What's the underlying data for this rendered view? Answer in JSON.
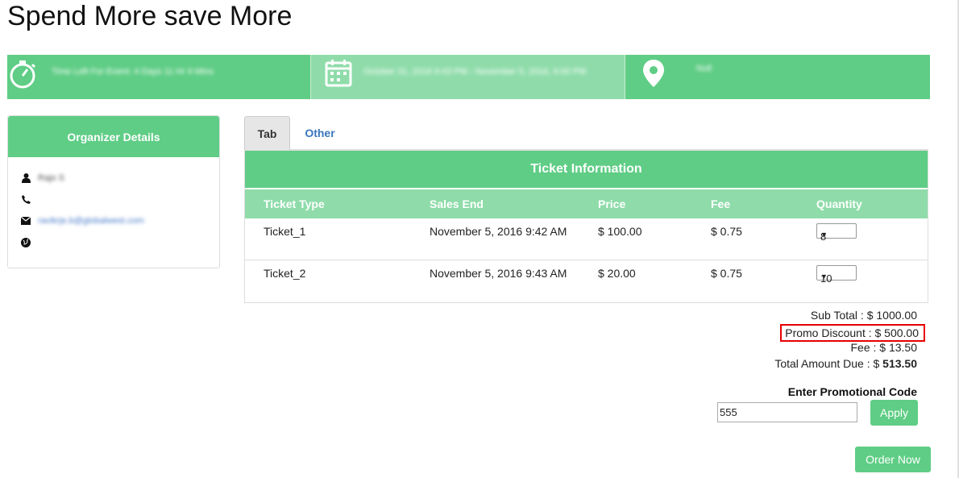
{
  "page": {
    "title": "Spend More save More"
  },
  "info_bar": {
    "time_left": "Time Left For Event: 4 Days 11 Hr 9 Mins",
    "date_range": "October 31, 2016 9:43 PM - November 5, 2016, 9:00 PM",
    "location": "Null",
    "colors": {
      "primary": "#5fcd85",
      "secondary": "#8fdcaa"
    }
  },
  "organizer": {
    "header": "Organizer Details",
    "name": "Rajo S",
    "phone": "",
    "email": "ravikrje.b@globalwest.com",
    "website": ""
  },
  "tabs": [
    {
      "label": "Tab",
      "active": true
    },
    {
      "label": "Other",
      "active": false
    }
  ],
  "tickets": {
    "header": "Ticket Information",
    "columns": [
      "Ticket Type",
      "Sales End",
      "Price",
      "Fee",
      "Quantity"
    ],
    "rows": [
      {
        "type": "Ticket_1",
        "sales_end": "November 5, 2016 9:42 AM",
        "price": "$ 100.00",
        "fee": "$ 0.75",
        "quantity": "8"
      },
      {
        "type": "Ticket_2",
        "sales_end": "November 5, 2016 9:43 AM",
        "price": "$ 20.00",
        "fee": "$ 0.75",
        "quantity": "10"
      }
    ]
  },
  "summary": {
    "sub_total": "Sub Total : $ 1000.00",
    "promo_discount": "Promo Discount : $ 500.00",
    "fee": "Fee : $ 13.50",
    "total_label": "Total Amount Due : $ ",
    "total_value": "513.50"
  },
  "promo": {
    "label": "Enter Promotional Code",
    "value": "555",
    "apply_label": "Apply"
  },
  "order": {
    "label": "Order Now"
  }
}
